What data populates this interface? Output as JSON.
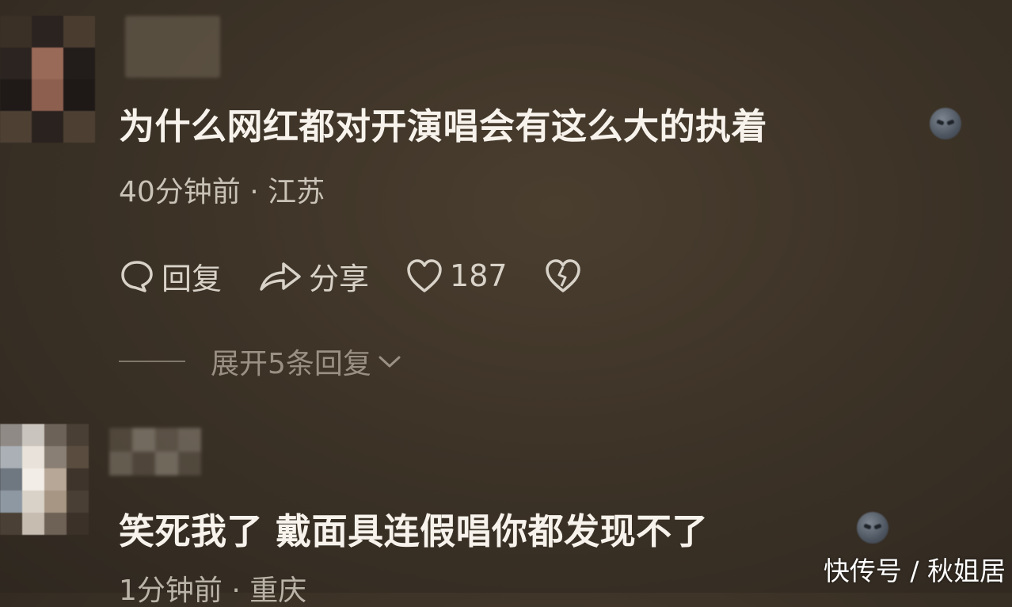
{
  "comments": [
    {
      "text": "为什么网红都对开演唱会有这么大的执着",
      "time": "40分钟前",
      "location": "江苏",
      "actions": {
        "reply_label": "回复",
        "share_label": "分享",
        "like_count": "187"
      },
      "expand_label": "展开5条回复"
    },
    {
      "text": "笑死我了 戴面具连假唱你都发现不了",
      "meta_partial": "1分钟前 · 重庆"
    }
  ],
  "watermark": "快传号 / 秋姐居",
  "icons": [
    "comment-bubble-icon",
    "share-arrow-icon",
    "heart-icon",
    "broken-heart-icon",
    "chevron-down-icon",
    "emoji-icon"
  ]
}
